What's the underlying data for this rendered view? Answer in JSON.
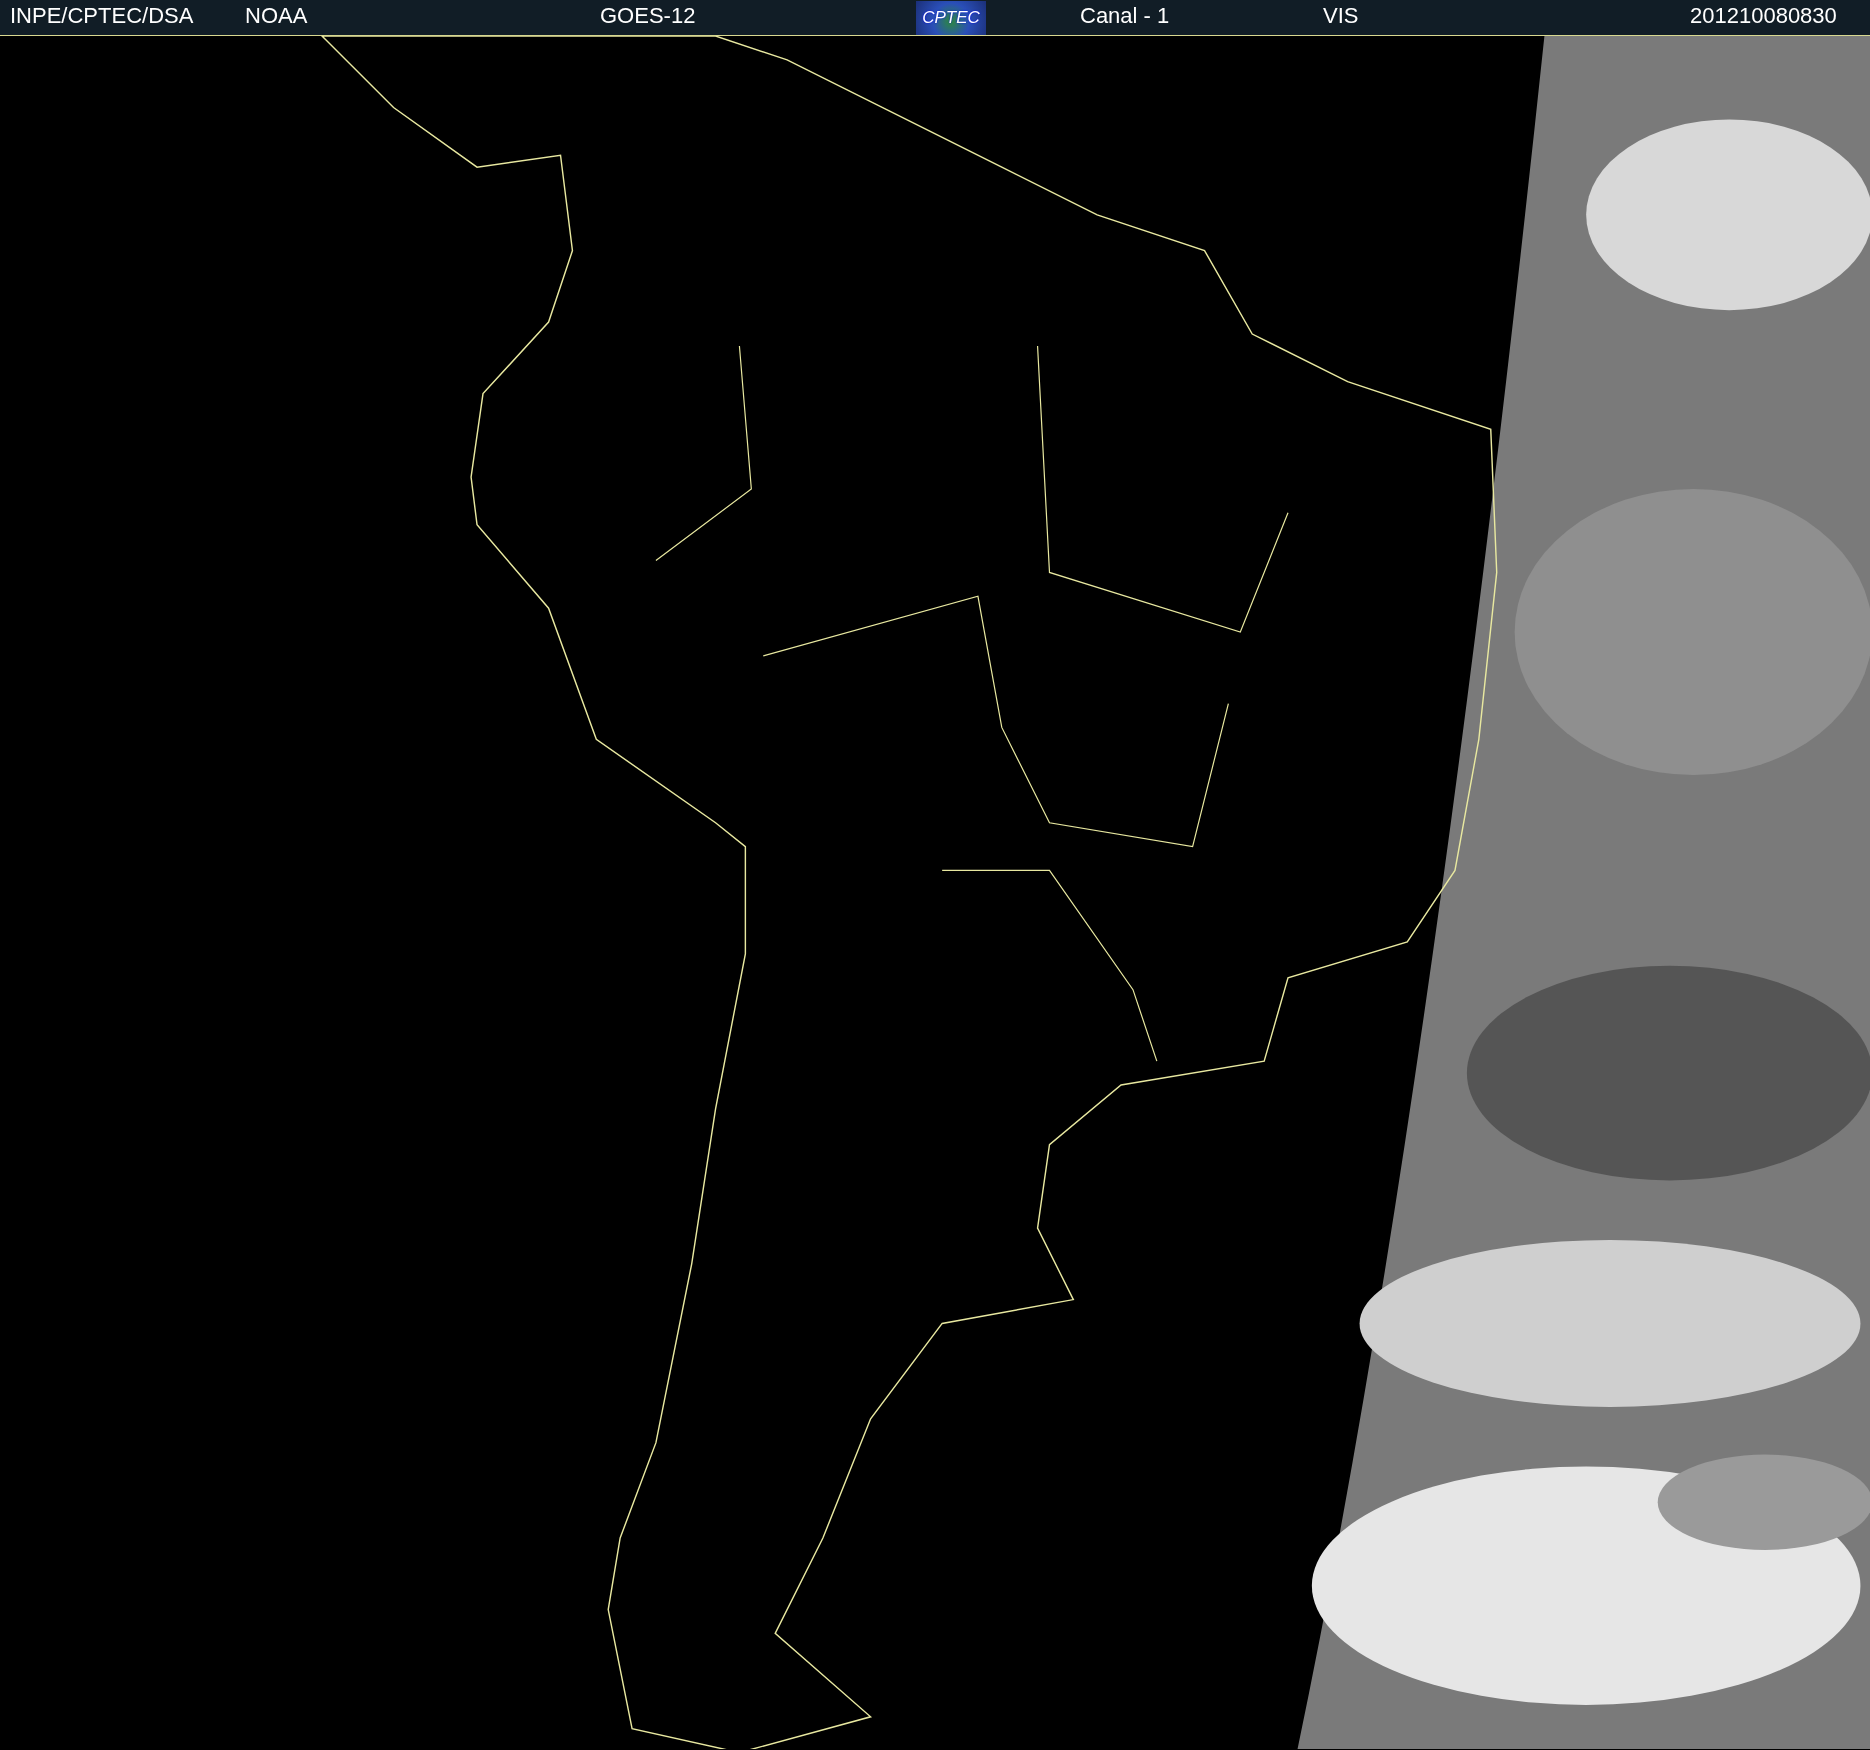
{
  "header": {
    "items": [
      {
        "kind": "text",
        "text": "INPE/CPTEC/DSA"
      },
      {
        "kind": "text",
        "text": "NOAA"
      },
      {
        "kind": "text",
        "text": "GOES-12"
      },
      {
        "kind": "logo",
        "text": "CPTEC"
      },
      {
        "kind": "text",
        "text": "Canal - 1"
      },
      {
        "kind": "text",
        "text": "VIS"
      },
      {
        "kind": "text",
        "text": "201210080830"
      }
    ]
  }
}
